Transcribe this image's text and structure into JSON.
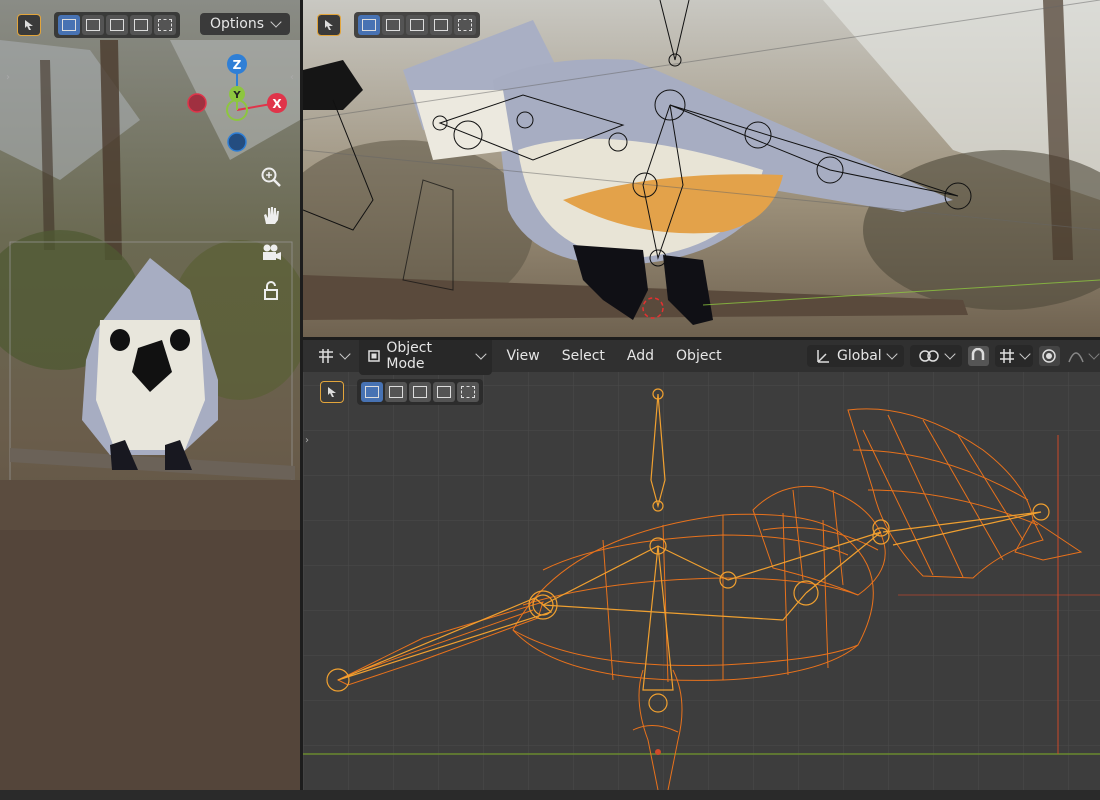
{
  "camera_view": {
    "options_label": "Options",
    "gizmo": {
      "z": "Z",
      "y": "Y",
      "x": "X"
    },
    "icons": [
      "zoom-icon",
      "hand-icon",
      "camera-icon",
      "lock-icon"
    ]
  },
  "bottom_view": {
    "menu": {
      "mode_label": "Object Mode",
      "view_label": "View",
      "select_label": "Select",
      "add_label": "Add",
      "object_label": "Object",
      "orientation_label": "Global"
    }
  },
  "colors": {
    "wire_orange": "#e8721c",
    "bone_orange": "#f0a030",
    "selection_accent": "#4772b3",
    "axis_x": "#e0344a",
    "axis_y": "#8dc63f",
    "axis_z": "#2f7fd6"
  }
}
